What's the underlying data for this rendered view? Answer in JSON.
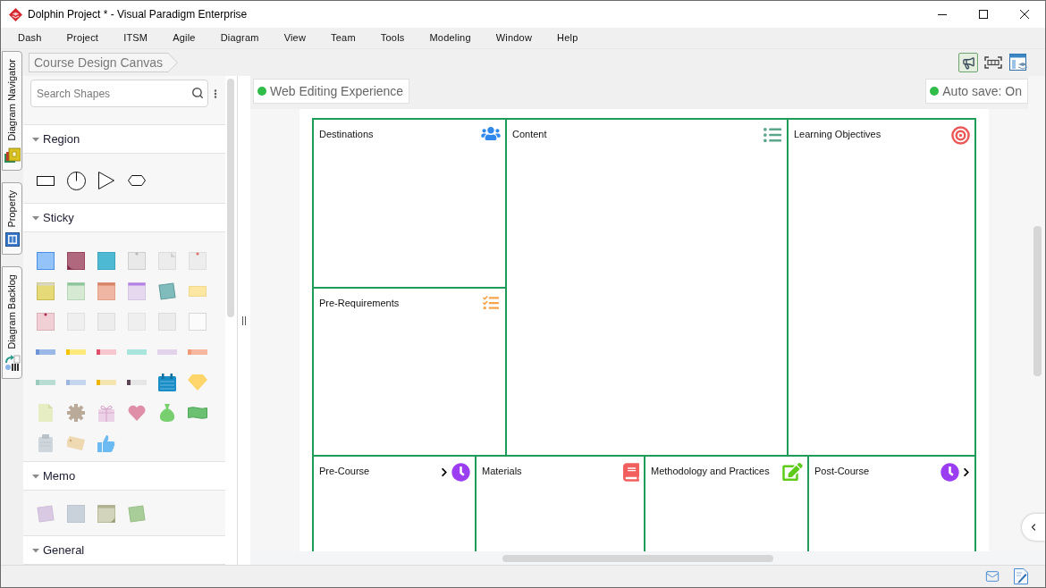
{
  "window": {
    "title": "Dolphin Project * - Visual Paradigm Enterprise"
  },
  "menu": [
    "Dash",
    "Project",
    "ITSM",
    "Agile",
    "Diagram",
    "View",
    "Team",
    "Tools",
    "Modeling",
    "Window",
    "Help"
  ],
  "side_tabs": [
    {
      "label": "Diagram Navigator"
    },
    {
      "label": "Property"
    },
    {
      "label": "Diagram Backlog"
    }
  ],
  "breadcrumb": "Course Design Canvas",
  "toolbar": [
    {
      "selected": true
    },
    {
      "selected": false
    },
    {
      "selected": false
    }
  ],
  "palette": {
    "search": {
      "placeholder": "Search Shapes"
    },
    "sections": [
      {
        "title": "Region",
        "kind": "region",
        "expanded": true
      },
      {
        "title": "Sticky",
        "kind": "sticky",
        "expanded": true
      },
      {
        "title": "Memo",
        "kind": "memo",
        "expanded": true
      },
      {
        "title": "General",
        "kind": "general",
        "expanded": true
      }
    ]
  },
  "status_badges": [
    {
      "label": "Web Editing Experience"
    },
    {
      "label": "Auto save: On"
    }
  ],
  "canvas": {
    "columns": [
      {
        "blocks": [
          {
            "title": "Destinations"
          },
          {
            "title": "Pre-Requirements"
          }
        ]
      },
      {
        "blocks": [
          {
            "title": "Content"
          }
        ]
      },
      {
        "blocks": [
          {
            "title": "Learning Objectives"
          }
        ]
      }
    ],
    "bottom_row": [
      {
        "title": "Pre-Course"
      },
      {
        "title": "Materials"
      },
      {
        "title": "Methodology and Practices"
      },
      {
        "title": "Post-Course"
      }
    ]
  }
}
